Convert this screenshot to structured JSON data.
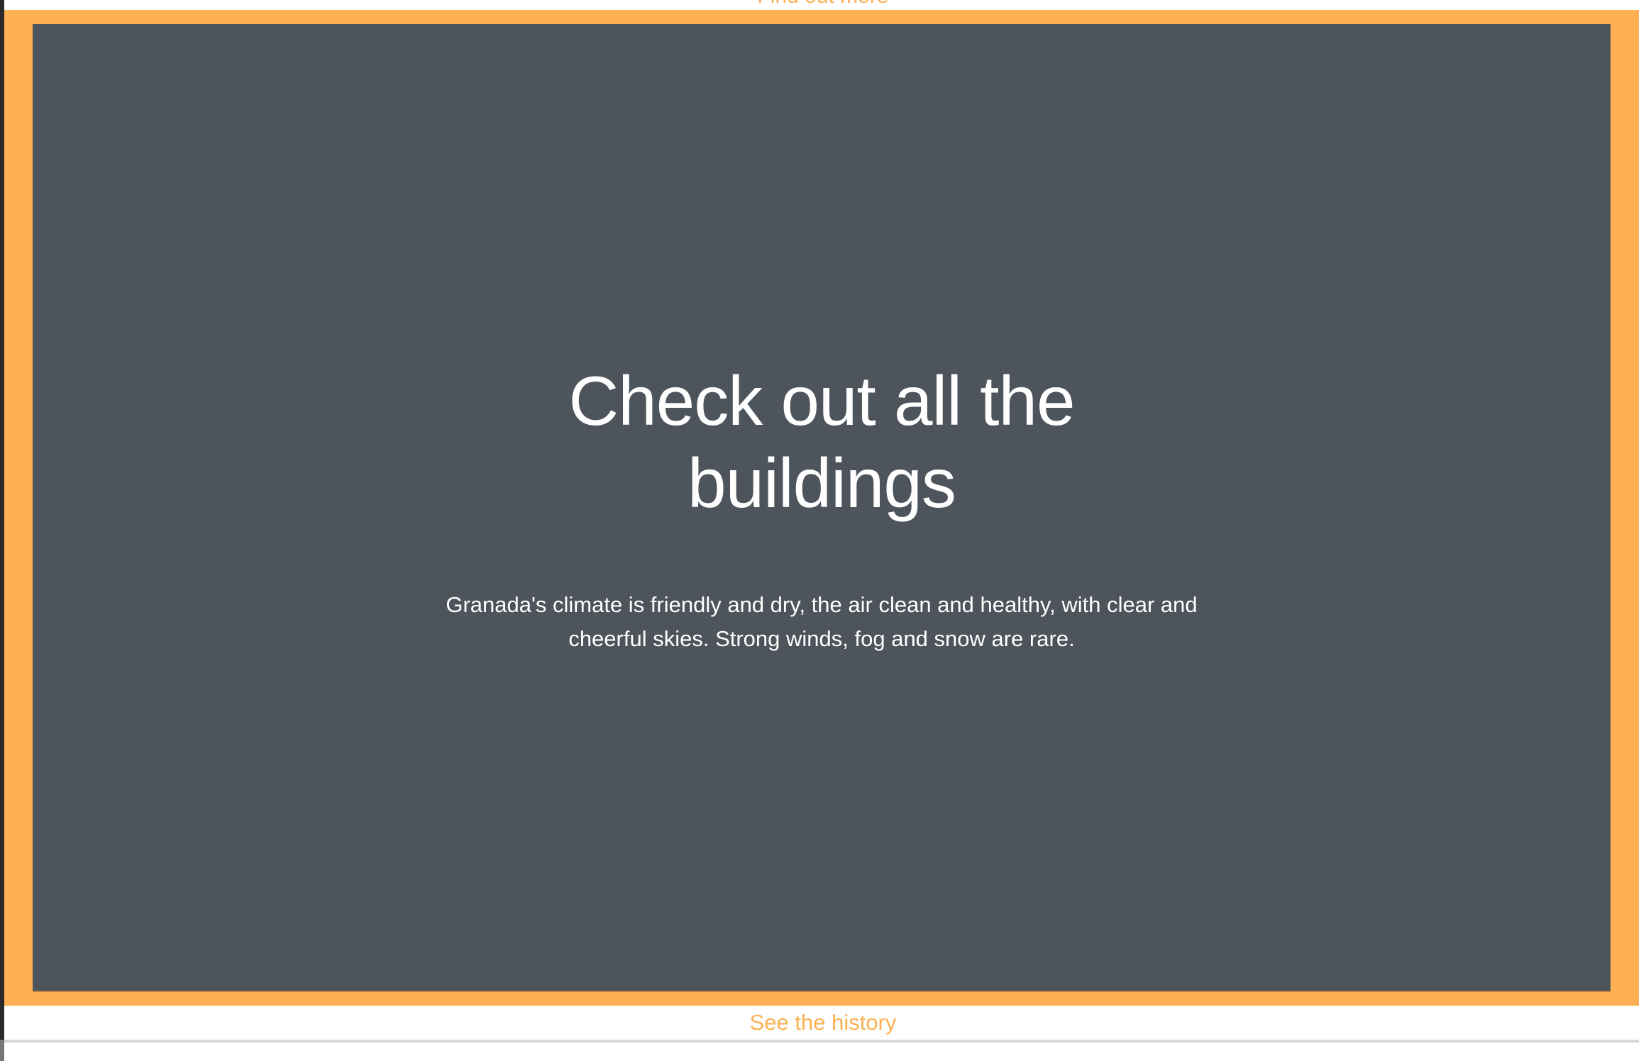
{
  "top_link": "Find out more",
  "hero": {
    "title": "Check out all the buildings",
    "description": "Granada's climate is friendly and dry, the air clean and healthy, with clear and cheerful skies. Strong winds, fog and snow are rare."
  },
  "bottom_link": "See the history",
  "colors": {
    "accent": "#ffb052",
    "panel": "#4d545b"
  }
}
